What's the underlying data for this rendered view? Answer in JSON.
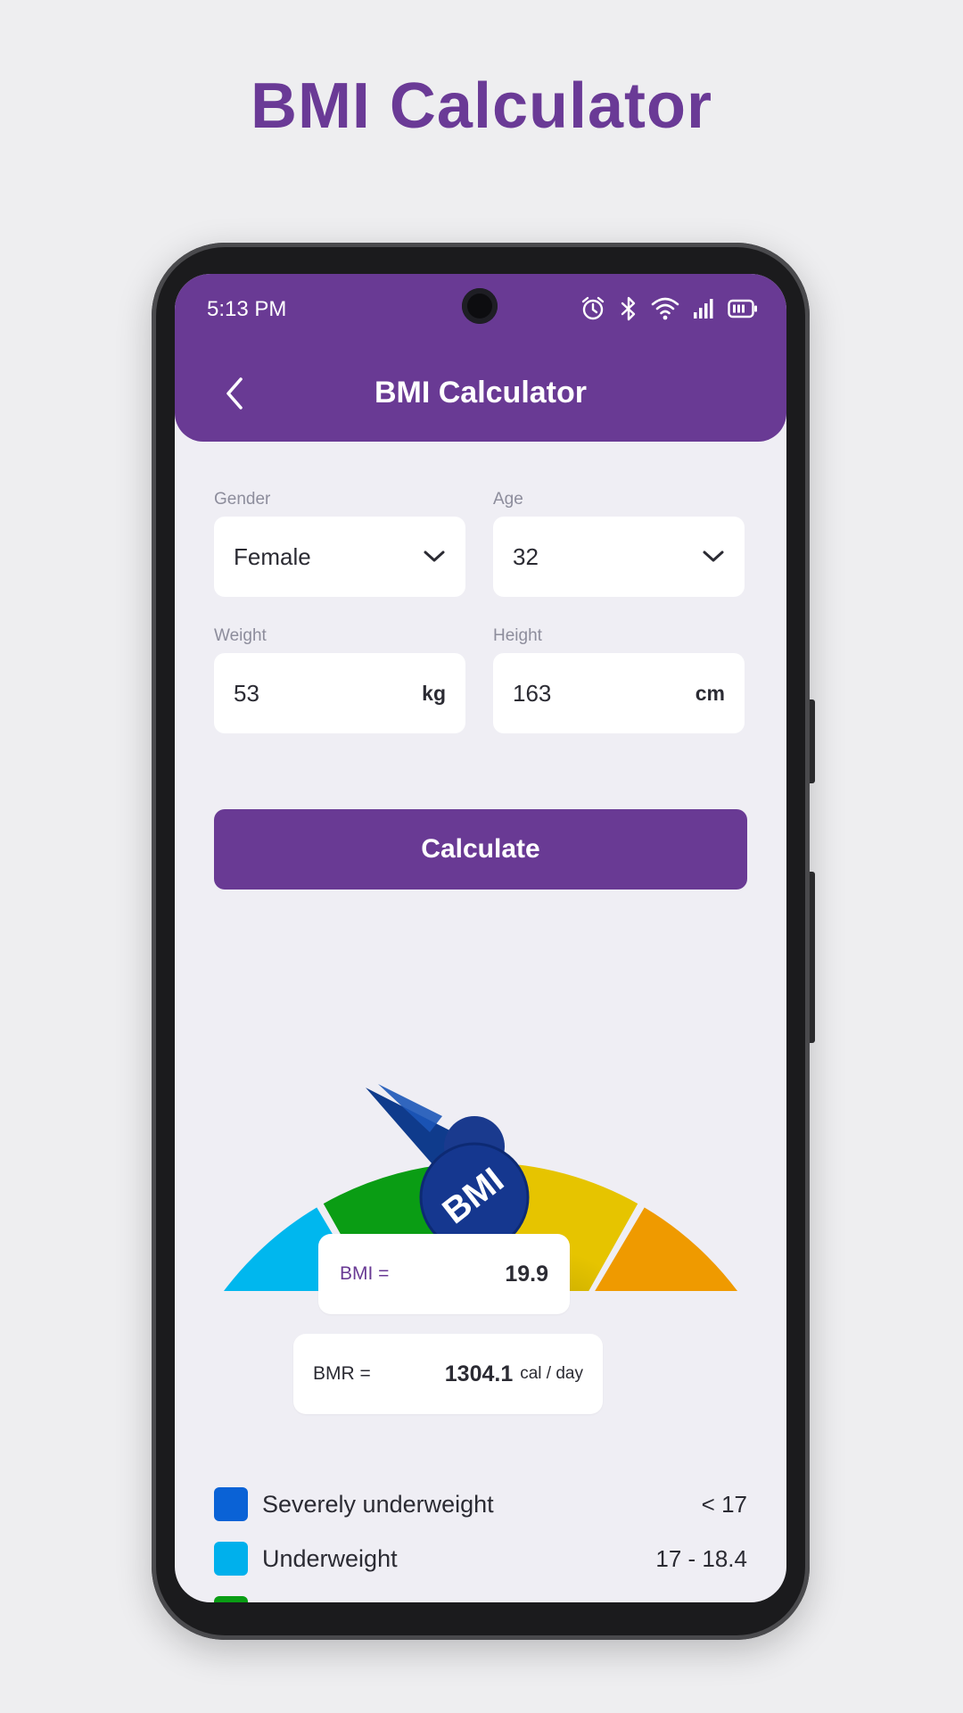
{
  "promo": {
    "title": "BMI Calculator"
  },
  "status_bar": {
    "time": "5:13 PM"
  },
  "app_bar": {
    "title": "BMI Calculator"
  },
  "form": {
    "gender": {
      "label": "Gender",
      "value": "Female"
    },
    "age": {
      "label": "Age",
      "value": "32"
    },
    "weight": {
      "label": "Weight",
      "value": "53",
      "unit": "kg"
    },
    "height": {
      "label": "Height",
      "value": "163",
      "unit": "cm"
    },
    "calculate_label": "Calculate"
  },
  "gauge": {
    "badge_text": "BMI",
    "segment_colors": [
      "#0a62d6",
      "#00b7ee",
      "#0a9d14",
      "#e6c400",
      "#ef9a00",
      "#e61408"
    ]
  },
  "results": {
    "bmi_label": "BMI =",
    "bmi_value": "19.9",
    "bmr_label": "BMR =",
    "bmr_value": "1304.1",
    "bmr_unit": "cal / day"
  },
  "legend": [
    {
      "label": "Severely underweight",
      "range": "< 17",
      "color": "#0a62d6"
    },
    {
      "label": "Underweight",
      "range": "17 - 18.4",
      "color": "#00b0ec"
    },
    {
      "label": "",
      "range": "",
      "color": "#0a9d14"
    }
  ],
  "colors": {
    "accent": "#693a94",
    "background": "#efeef4"
  }
}
